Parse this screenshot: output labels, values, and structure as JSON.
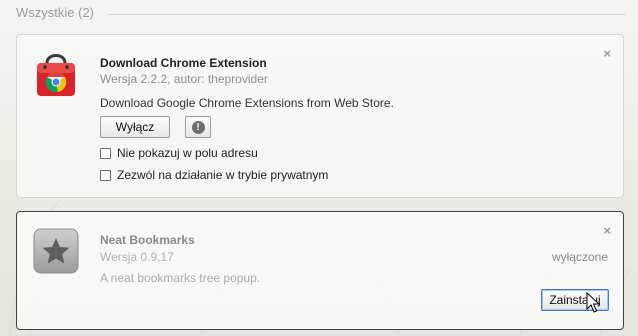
{
  "section": {
    "title": "Wszystkie (2)"
  },
  "extensions": [
    {
      "name": "Download Chrome Extension",
      "version": "Wersja 2.2.2, autor: theprovider",
      "description": "Download Google Chrome Extensions from Web Store.",
      "icon": "red-shopping-bag-chrome-icon",
      "disable_label": "Wyłącz",
      "info_icon": "exclamation-icon",
      "close_glyph": "×",
      "options": [
        {
          "label": "Nie pokazuj w polu adresu",
          "checked": false
        },
        {
          "label": "Zezwól na działanie w trybie prywatnym",
          "checked": false
        }
      ]
    },
    {
      "name": "Neat Bookmarks",
      "version": "Wersja 0.9.17",
      "description": "A neat bookmarks tree popup.",
      "icon": "star-icon",
      "status": "wyłączone",
      "install_label": "Zainstaluj",
      "close_glyph": "×"
    }
  ],
  "colors": {
    "accent_border": "#4a78b8",
    "selected_card_border": "#444444",
    "muted_text": "#8e8e8e"
  }
}
